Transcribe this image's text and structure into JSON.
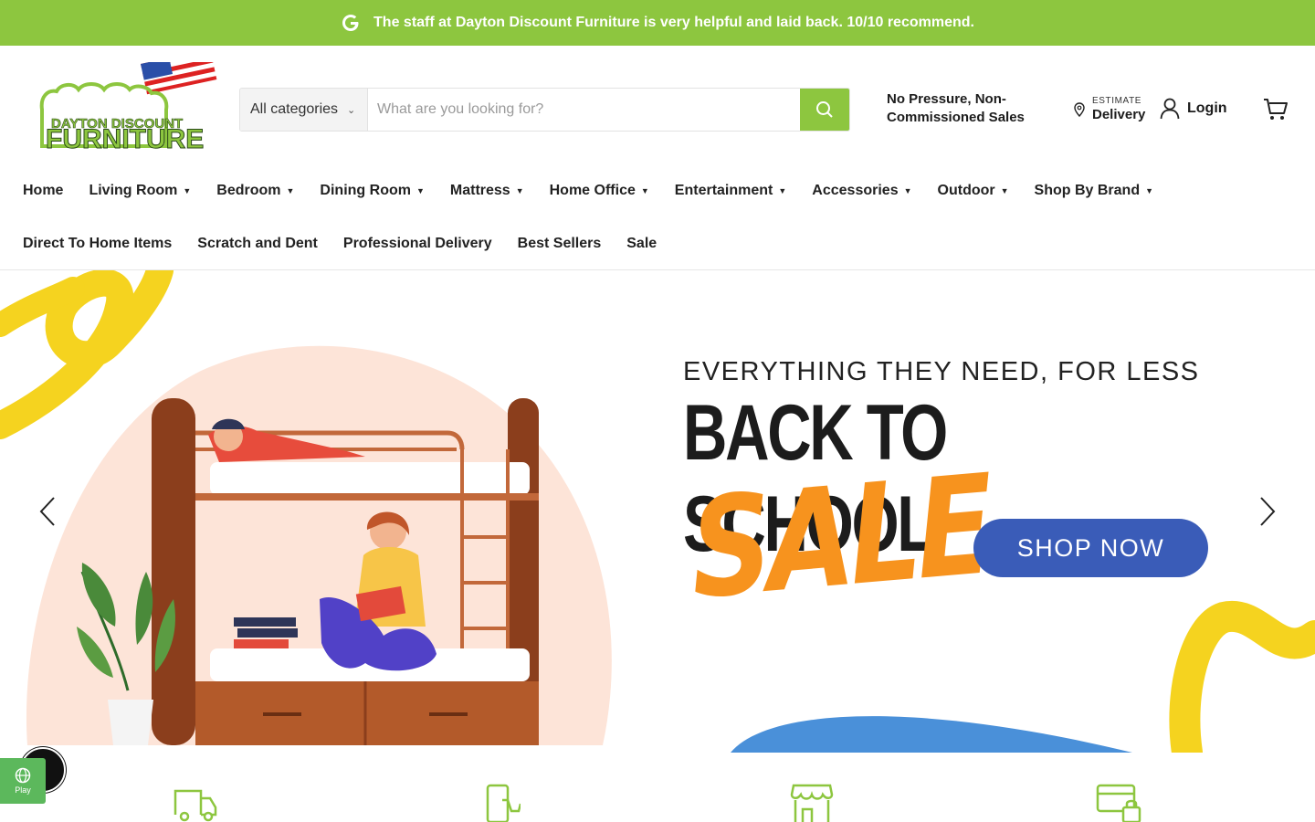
{
  "announcement": {
    "text": "The staff at Dayton Discount Furniture is very helpful and laid back. 10/10 recommend.",
    "icon": "google-g-icon"
  },
  "header": {
    "logo_line1": "DAYTON DISCOUNT",
    "logo_line2": "FURNITURE",
    "search": {
      "category_label": "All categories",
      "placeholder": "What are you looking for?",
      "button_icon": "search-icon"
    },
    "tagline": "No Pressure, Non-Commissioned Sales",
    "delivery": {
      "small": "ESTIMATE",
      "big": "Delivery"
    },
    "login_label": "Login",
    "cart_icon": "cart-icon"
  },
  "nav": {
    "row1": [
      {
        "label": "Home",
        "dropdown": false
      },
      {
        "label": "Living Room",
        "dropdown": true
      },
      {
        "label": "Bedroom",
        "dropdown": true
      },
      {
        "label": "Dining Room",
        "dropdown": true
      },
      {
        "label": "Mattress",
        "dropdown": true
      },
      {
        "label": "Home Office",
        "dropdown": true
      },
      {
        "label": "Entertainment",
        "dropdown": true
      },
      {
        "label": "Accessories",
        "dropdown": true
      },
      {
        "label": "Outdoor",
        "dropdown": true
      },
      {
        "label": "Shop By Brand",
        "dropdown": true
      }
    ],
    "row2": [
      {
        "label": "Direct To Home Items",
        "dropdown": false
      },
      {
        "label": "Scratch and Dent",
        "dropdown": false
      },
      {
        "label": "Professional Delivery",
        "dropdown": false
      },
      {
        "label": "Best Sellers",
        "dropdown": false
      },
      {
        "label": "Sale",
        "dropdown": false
      }
    ]
  },
  "hero": {
    "eyebrow": "EVERYTHING THEY NEED, FOR LESS",
    "headline": "BACK TO SCHOOL",
    "sale_word": "SALE",
    "cta_label": "SHOP NOW",
    "prev_icon": "chevron-left-icon",
    "next_icon": "chevron-right-icon"
  },
  "widgets": {
    "play_label": "Play"
  },
  "colors": {
    "brand_green": "#8dc63f",
    "cta_blue": "#3a5cb8",
    "sale_orange": "#f7931e",
    "accent_yellow": "#f5d31f"
  }
}
